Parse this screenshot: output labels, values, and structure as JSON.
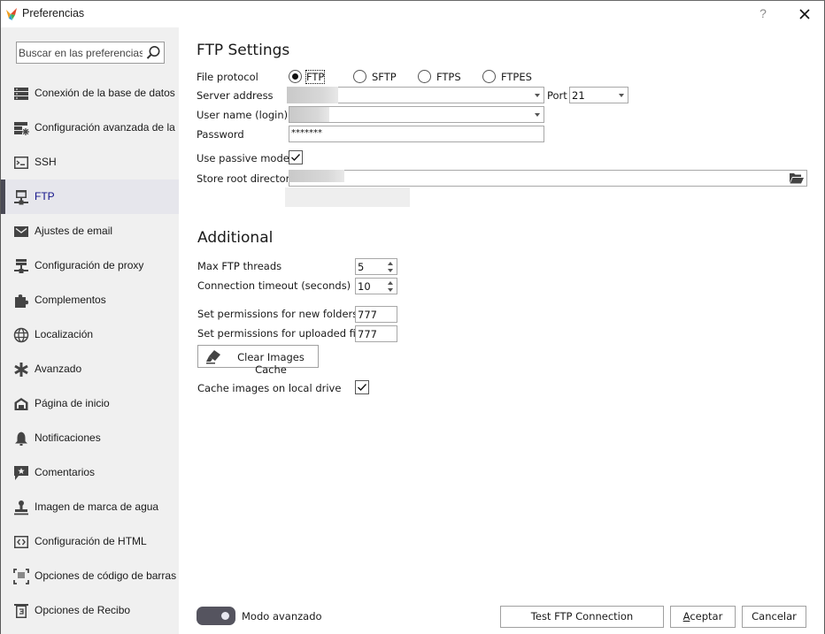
{
  "window": {
    "title": "Preferencias",
    "help_label": "?",
    "close_label": "close"
  },
  "sidebar": {
    "search_placeholder": "Buscar en las preferencias",
    "items": [
      {
        "label": "Conexión de la base de datos",
        "icon": "database-icon",
        "active": false
      },
      {
        "label": "Configuración avanzada de la ...",
        "icon": "database-settings-icon",
        "active": false
      },
      {
        "label": "SSH",
        "icon": "terminal-icon",
        "active": false
      },
      {
        "label": "FTP",
        "icon": "network-folder-icon",
        "active": true
      },
      {
        "label": "Ajustes de email",
        "icon": "envelope-icon",
        "active": false
      },
      {
        "label": "Configuración de proxy",
        "icon": "server-network-icon",
        "active": false
      },
      {
        "label": "Complementos",
        "icon": "puzzle-icon",
        "active": false
      },
      {
        "label": "Localización",
        "icon": "globe-icon",
        "active": false
      },
      {
        "label": "Avanzado",
        "icon": "asterisk-icon",
        "active": false
      },
      {
        "label": "Página de inicio",
        "icon": "home-icon",
        "active": false
      },
      {
        "label": "Notificaciones",
        "icon": "bell-icon",
        "active": false
      },
      {
        "label": "Comentarios",
        "icon": "comment-star-icon",
        "active": false
      },
      {
        "label": "Imagen de marca de agua",
        "icon": "stamp-icon",
        "active": false
      },
      {
        "label": "Configuración de HTML",
        "icon": "code-icon",
        "active": false
      },
      {
        "label": "Opciones de código de barras",
        "icon": "barcode-scan-icon",
        "active": false
      },
      {
        "label": "Opciones de Recibo",
        "icon": "receipt-icon",
        "active": false
      }
    ]
  },
  "ftp_settings": {
    "title": "FTP Settings",
    "file_protocol_label": "File protocol",
    "protocols": [
      {
        "label": "FTP",
        "checked": true
      },
      {
        "label": "SFTP",
        "checked": false
      },
      {
        "label": "FTPS",
        "checked": false
      },
      {
        "label": "FTPES",
        "checked": false
      }
    ],
    "server_address_label": "Server address",
    "server_address_value": "",
    "port_label": "Port",
    "port_value": "21",
    "username_label": "User name (login)",
    "username_value": "",
    "password_label": "Password",
    "password_value": "*******",
    "passive_mode_label": "Use passive mode",
    "passive_mode_checked": true,
    "root_dir_label": "Store root directory",
    "root_dir_value": ""
  },
  "additional": {
    "title": "Additional",
    "max_threads_label": "Max FTP threads",
    "max_threads_value": "5",
    "timeout_label": "Connection timeout (seconds)",
    "timeout_value": "10",
    "perm_folders_label": "Set permissions for new folders",
    "perm_folders_value": "777",
    "perm_files_label": "Set permissions for uploaded files",
    "perm_files_value": "777",
    "clear_cache_label": "Clear Images Cache",
    "cache_local_label": "Cache images on local drive",
    "cache_local_checked": true
  },
  "footer": {
    "advanced_mode_label": "Modo avanzado",
    "advanced_mode_on": true,
    "test_button": "Test FTP Connection",
    "accept_button": "Aceptar",
    "cancel_button": "Cancelar"
  }
}
